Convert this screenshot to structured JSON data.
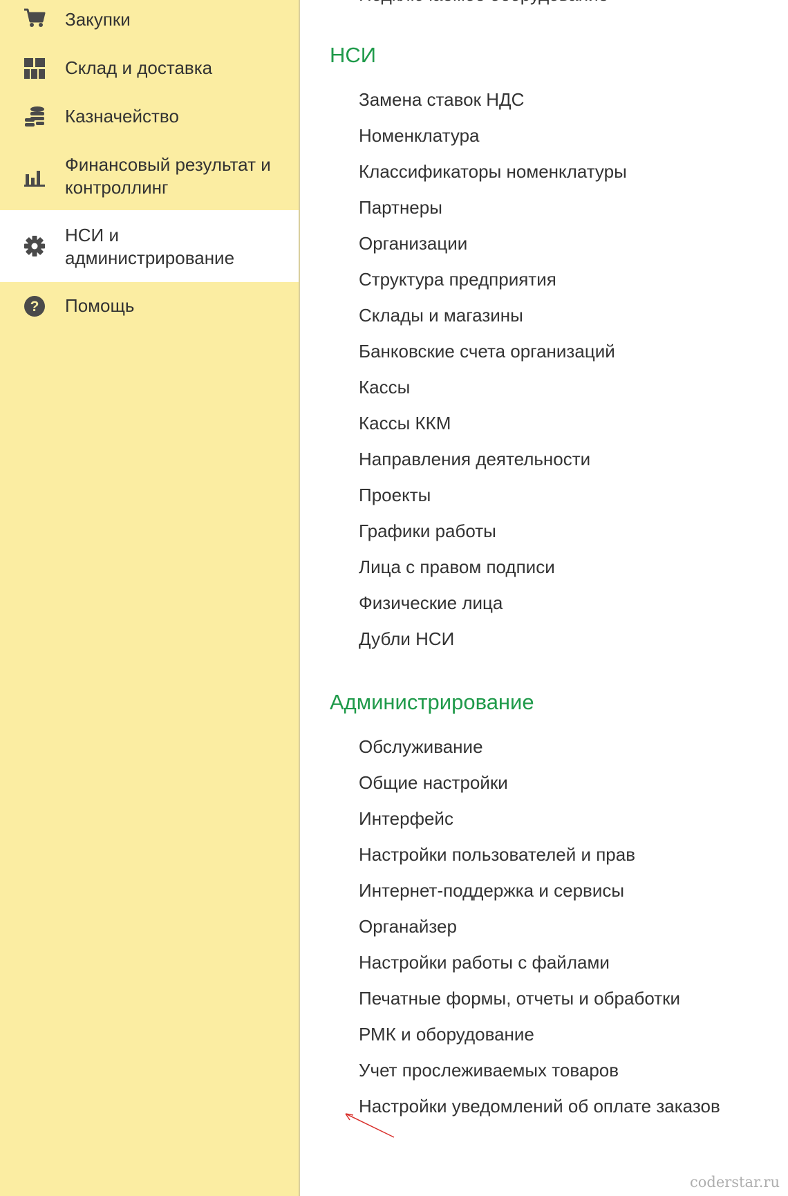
{
  "sidebar": {
    "items": [
      {
        "label": "Закупки",
        "icon": "cart-icon"
      },
      {
        "label": "Склад и доставка",
        "icon": "warehouse-grid-icon"
      },
      {
        "label": "Казначейство",
        "icon": "coins-icon"
      },
      {
        "label": "Финансовый результат и контроллинг",
        "icon": "bar-chart-icon"
      },
      {
        "label": "НСИ и администрирование",
        "icon": "gear-icon",
        "active": true
      },
      {
        "label": "Помощь",
        "icon": "question-icon"
      }
    ]
  },
  "content": {
    "partial_top_text": "Подключаемое оборудование",
    "sections": [
      {
        "title": "НСИ",
        "items": [
          "Замена ставок НДС",
          "Номенклатура",
          "Классификаторы номенклатуры",
          "Партнеры",
          "Организации",
          "Структура предприятия",
          "Склады и магазины",
          "Банковские счета организаций",
          "Кассы",
          "Кассы ККМ",
          "Направления деятельности",
          "Проекты",
          "Графики работы",
          "Лица с правом подписи",
          "Физические лица",
          "Дубли НСИ"
        ]
      },
      {
        "title": "Администрирование",
        "items": [
          "Обслуживание",
          "Общие настройки",
          "Интерфейс",
          "Настройки пользователей и прав",
          "Интернет-поддержка и сервисы",
          "Органайзер",
          "Настройки работы с файлами",
          "Печатные формы, отчеты и обработки",
          "РМК и оборудование",
          "Учет прослеживаемых товаров",
          "Настройки уведомлений об оплате заказов"
        ]
      }
    ]
  },
  "watermark": "coderstar.ru",
  "colors": {
    "sidebar_bg": "#fbeda2",
    "active_bg": "#ffffff",
    "section_title": "#1f9a4a",
    "text": "#333333",
    "icon": "#4a4a4a",
    "annotation_arrow": "#d9302c"
  }
}
